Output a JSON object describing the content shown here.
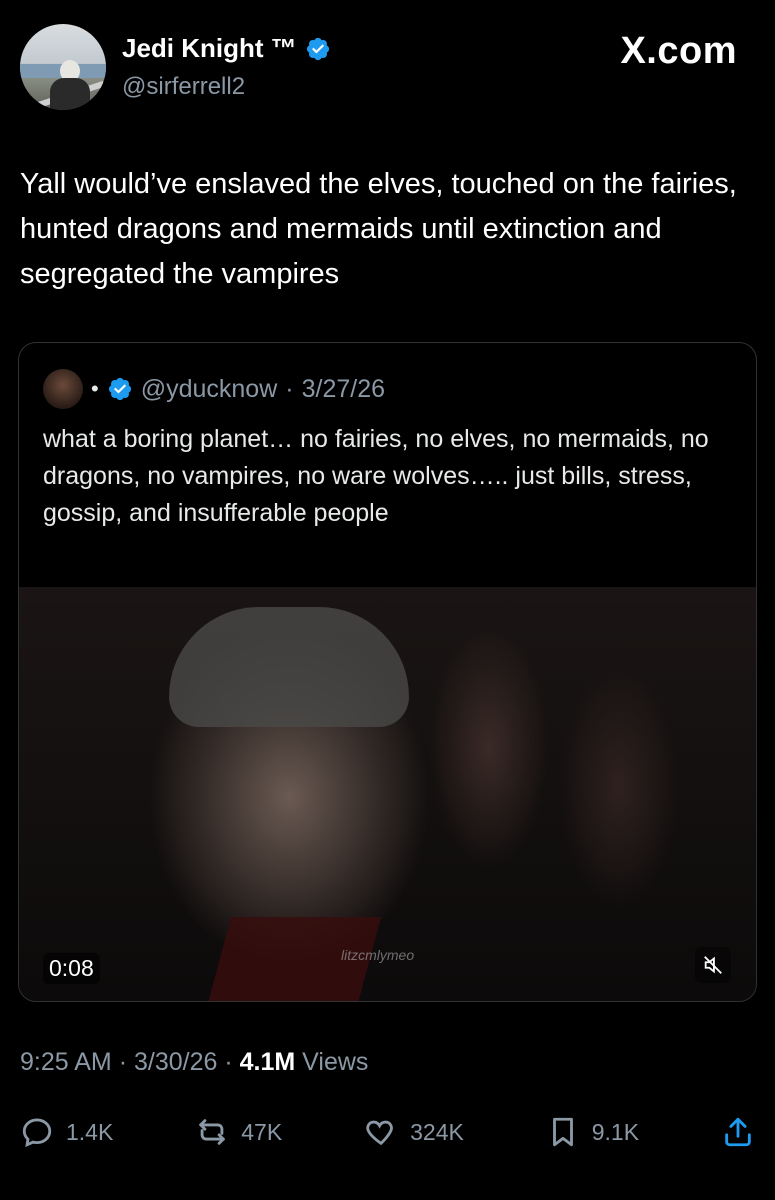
{
  "author": {
    "name": "Jedi Knight ™",
    "handle": "@sirferrell2"
  },
  "brand_label": "X.com",
  "tweet_text": "Yall would’ve enslaved the elves, touched on the fairies, hunted dragons and mermaids until extinction and segregated the vampires",
  "quoted": {
    "dot": "•",
    "handle": "@yducknow",
    "separator": "·",
    "date": "3/27/26",
    "text": "what a boring planet… no fairies, no elves, no mermaids, no dragons, no vampires, no ware wolves….. just bills, stress, gossip, and insufferable people",
    "video_time": "0:08",
    "watermark": "litzcmlymeo"
  },
  "meta": {
    "time": "9:25 AM",
    "sep1": "·",
    "date": "3/30/26",
    "sep2": "·",
    "views_count": "4.1M",
    "views_label": "Views"
  },
  "actions": {
    "replies": "1.4K",
    "reposts": "47K",
    "likes": "324K",
    "bookmarks": "9.1K"
  },
  "colors": {
    "background": "#000000",
    "text": "#e7e9ea",
    "secondary": "#8b98a5",
    "verified": "#1d9bf0",
    "border": "#2f3336"
  },
  "icons": [
    "verified-badge-icon",
    "mute-icon",
    "reply-icon",
    "repost-icon",
    "like-icon",
    "bookmark-icon",
    "share-icon"
  ]
}
